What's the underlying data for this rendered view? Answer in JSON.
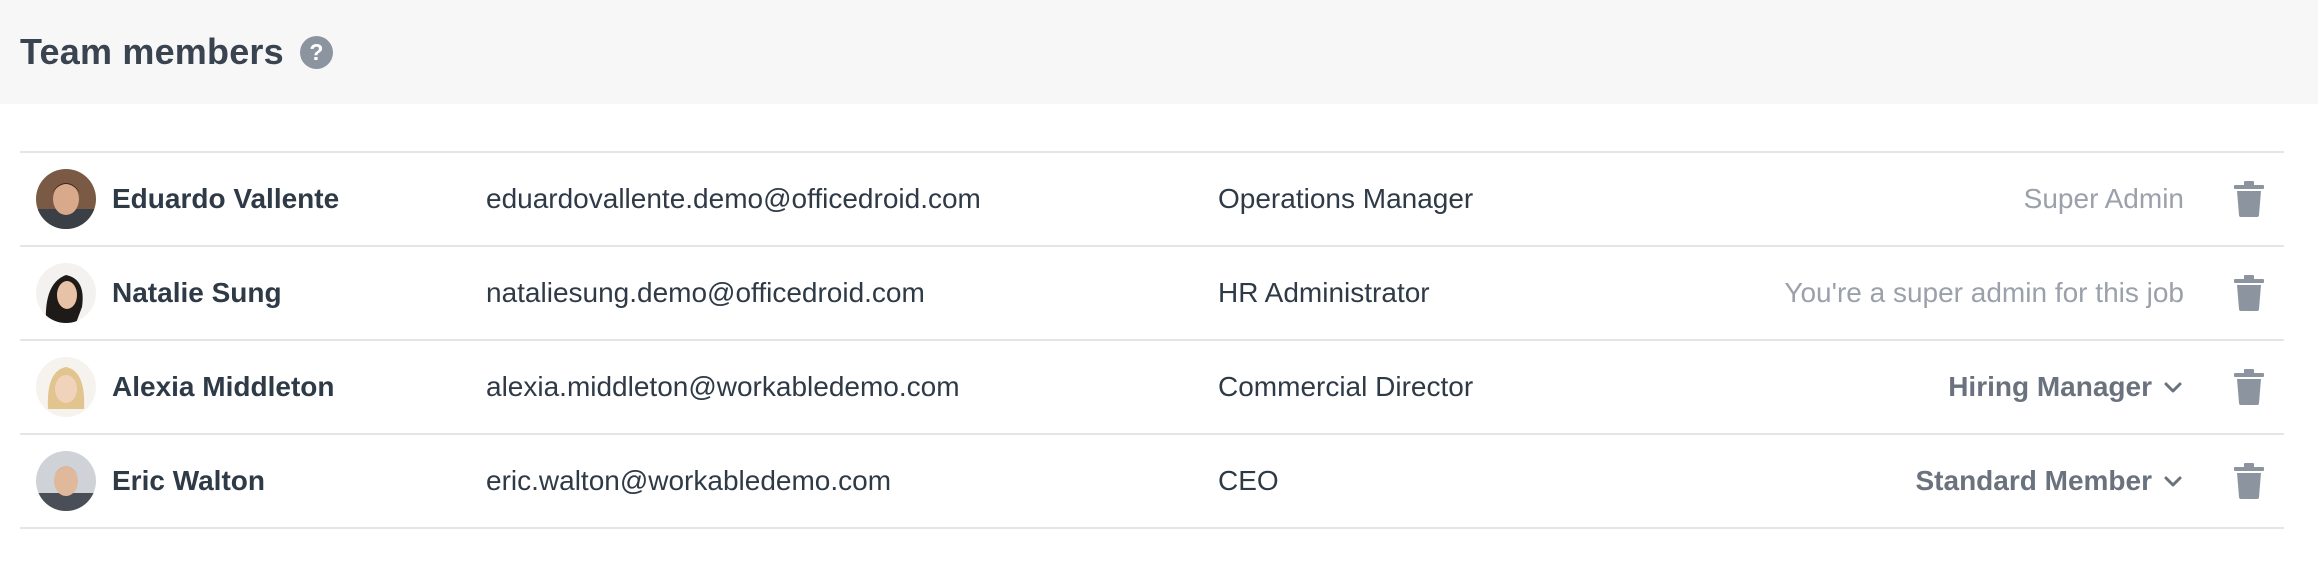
{
  "header": {
    "title": "Team members",
    "help_icon": "question-circle-icon",
    "help_glyph": "?"
  },
  "members": [
    {
      "name": "Eduardo Vallente",
      "email": "eduardovallente.demo@officedroid.com",
      "job_title": "Operations Manager",
      "role": "Super Admin",
      "role_editable": false
    },
    {
      "name": "Natalie Sung",
      "email": "nataliesung.demo@officedroid.com",
      "job_title": "HR Administrator",
      "role": "You're a super admin for this job",
      "role_editable": false
    },
    {
      "name": "Alexia Middleton",
      "email": "alexia.middleton@workabledemo.com",
      "job_title": "Commercial Director",
      "role": "Hiring Manager",
      "role_editable": true
    },
    {
      "name": "Eric Walton",
      "email": "eric.walton@workabledemo.com",
      "job_title": "CEO",
      "role": "Standard Member",
      "role_editable": true
    }
  ],
  "colors": {
    "header_bg": "#f7f7f7",
    "text": "#2f3a47",
    "muted": "#9aa1ab",
    "icon": "#8c94a0",
    "divider": "#e3e5e8"
  }
}
